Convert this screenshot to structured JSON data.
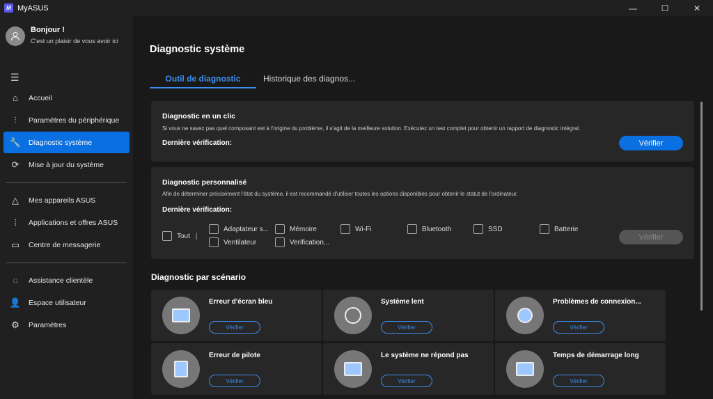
{
  "app": {
    "title": "MyASUS",
    "logo_text": "M"
  },
  "window_controls": {
    "minimize": "—",
    "maximize": "☐",
    "close": "✕"
  },
  "user": {
    "greeting": "Bonjour !",
    "subtitle": "C'est un plaisir de vous avoir ici"
  },
  "sidebar": {
    "menu_icon": "☰",
    "items": [
      {
        "label": "Accueil",
        "icon": "⌂"
      },
      {
        "label": "Paramètres du périphérique",
        "icon": "⫶"
      },
      {
        "label": "Diagnostic système",
        "icon": "🔧"
      },
      {
        "label": "Mise à jour du système",
        "icon": "⟳"
      },
      {
        "label": "Mes appareils ASUS",
        "icon": "△"
      },
      {
        "label": "Applications et offres ASUS",
        "icon": "⁞"
      },
      {
        "label": "Centre de messagerie",
        "icon": "▭"
      },
      {
        "label": "Assistance clientèle",
        "icon": "◌"
      },
      {
        "label": "Espace utilisateur",
        "icon": "👤"
      },
      {
        "label": "Paramètres",
        "icon": "⚙"
      }
    ]
  },
  "main": {
    "title": "Diagnostic système",
    "tabs": [
      {
        "label": "Outil de diagnostic",
        "active": true
      },
      {
        "label": "Historique des diagnos..."
      }
    ],
    "one_click": {
      "title": "Diagnostic en un clic",
      "description": "Si vous ne savez pas quel composant est à l'origine du problème, il s'agit de la meilleure solution. Exécutez un test complet pour obtenir un rapport de diagnostic intégral.",
      "last_check": "Dernière vérification:",
      "button": "Vérifier"
    },
    "custom": {
      "title": "Diagnostic personnalisé",
      "description": "Afin de déterminer précisément l'état du système, il est recommandé d'utiliser toutes les options disponibles pour obtenir le statut de l'ordinateur.",
      "last_check": "Dernière vérification:",
      "all": "Tout",
      "options": [
        "Adaptateur s...",
        "Mémoire",
        "Wi-Fi",
        "Bluetooth",
        "SSD",
        "Batterie",
        "Ventilateur",
        "Verification..."
      ],
      "button": "Vérifier"
    },
    "scenario_title": "Diagnostic par scénario",
    "scenarios": [
      {
        "title": "Erreur d'écran bleu",
        "button": "Vérifier"
      },
      {
        "title": "Système lent",
        "button": "Vérifier"
      },
      {
        "title": "Problèmes de connexion...",
        "button": "Vérifier"
      },
      {
        "title": "Erreur de pilote",
        "button": "Vérifier"
      },
      {
        "title": "Le système ne répond pas",
        "button": "Vérifier"
      },
      {
        "title": "Temps de démarrage long",
        "button": "Vérifier"
      }
    ]
  },
  "colors": {
    "accent": "#0a6fe0",
    "link": "#3d8ef0"
  }
}
